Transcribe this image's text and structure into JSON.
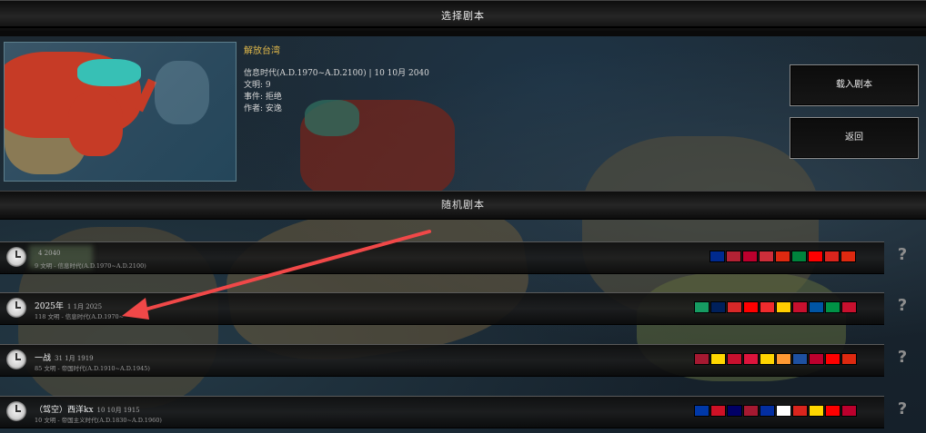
{
  "header": {
    "title": "选择剧本"
  },
  "selected": {
    "name": "解放台湾",
    "era": "信息时代(A.D.1970~A.D.2100) | 10 10月 2040",
    "civs": "文明: 9",
    "events": "事件: 拒绝",
    "author": "作者: 安逸"
  },
  "buttons": {
    "load": "载入剧本",
    "back": "返回"
  },
  "section": {
    "title": "随机剧本"
  },
  "scenarios": [
    {
      "name": "",
      "date": "4 2040",
      "sub": "9 文明 - 信息时代(A.D.1970~A.D.2100)",
      "help": "?",
      "flags": [
        "#002a8f",
        "#b22234",
        "#bc002d",
        "#cd2e3a",
        "#de2910",
        "#00843d",
        "#fe0000",
        "#da251d",
        "#de2910"
      ]
    },
    {
      "name": "2025年",
      "date": "1 1月 2025",
      "sub": "118 文明 - 信息时代(A.D.1970~",
      "help": "?",
      "flags": [
        "#169b62",
        "#00205b",
        "#d72828",
        "#ff0000",
        "#ef2b2d",
        "#ffcd00",
        "#c8102e",
        "#0055a4",
        "#009246",
        "#c8102e"
      ]
    },
    {
      "name": "一战",
      "date": "31 1月 1919",
      "sub": "85 文明 - 帝国时代(A.D.1910~A.D.1945)",
      "help": "?",
      "flags": [
        "#a51931",
        "#ffd700",
        "#c8102e",
        "#dc143c",
        "#ffd400",
        "#ff9933",
        "#1e50a0",
        "#bc002d",
        "#fe0000",
        "#de2910"
      ]
    },
    {
      "name": "（驾空）西洋kx",
      "date": "10 10月 1915",
      "sub": "10 文明 - 帝国主义时代(A.D.1830~A.D.1960)",
      "help": "?",
      "flags": [
        "#0038a8",
        "#ce1126",
        "#010066",
        "#a51931",
        "#032ea1",
        "#ffffff",
        "#da251d",
        "#ffd700",
        "#fe0000",
        "#bc002d"
      ]
    }
  ]
}
